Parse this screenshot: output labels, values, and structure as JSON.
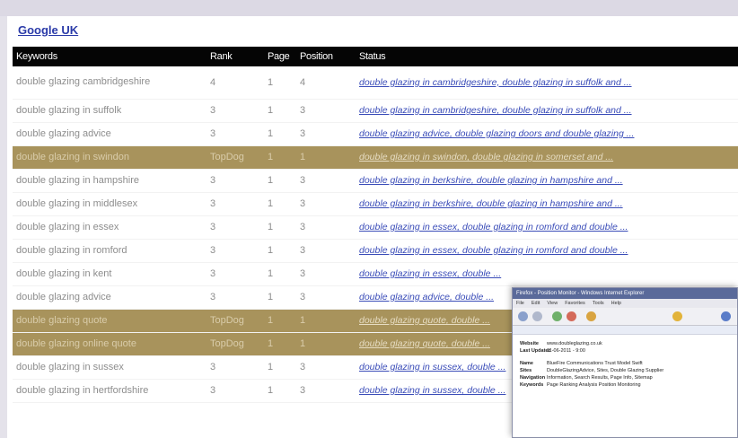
{
  "region_link": "Google UK",
  "table": {
    "headers": [
      "Keywords",
      "Rank",
      "Page",
      "Position",
      "Status"
    ],
    "rows": [
      {
        "keyword": "double glazing cambridgeshire",
        "rank": "4",
        "page": "1",
        "position": "4",
        "status": "double glazing in cambridgeshire, double glazing in suffolk and ...",
        "highlight": false
      },
      {
        "keyword": "double glazing in suffolk",
        "rank": "3",
        "page": "1",
        "position": "3",
        "status": "double glazing in cambridgeshire, double glazing in suffolk and ...",
        "highlight": false
      },
      {
        "keyword": "double glazing advice",
        "rank": "3",
        "page": "1",
        "position": "3",
        "status": "double glazing advice, double glazing doors and double glazing ...",
        "highlight": false
      },
      {
        "keyword": "double glazing in swindon",
        "rank": "TopDog",
        "page": "1",
        "position": "1",
        "status": "double glazing in swindon, double glazing in somerset and ...",
        "highlight": true
      },
      {
        "keyword": "double glazing in hampshire",
        "rank": "3",
        "page": "1",
        "position": "3",
        "status": "double glazing in berkshire, double glazing in hampshire and ...",
        "highlight": false
      },
      {
        "keyword": "double glazing in middlesex",
        "rank": "3",
        "page": "1",
        "position": "3",
        "status": "double glazing in berkshire, double glazing in hampshire and ...",
        "highlight": false
      },
      {
        "keyword": "double glazing in essex",
        "rank": "3",
        "page": "1",
        "position": "3",
        "status": "double glazing in essex, double glazing in romford and double ...",
        "highlight": false
      },
      {
        "keyword": "double glazing in romford",
        "rank": "3",
        "page": "1",
        "position": "3",
        "status": "double glazing in essex, double glazing in romford and double ...",
        "highlight": false
      },
      {
        "keyword": "double glazing in kent",
        "rank": "3",
        "page": "1",
        "position": "3",
        "status": "double glazing in essex, double ...",
        "highlight": false
      },
      {
        "keyword": "double glazing advice",
        "rank": "3",
        "page": "1",
        "position": "3",
        "status": "double glazing advice, double ...",
        "highlight": false
      },
      {
        "keyword": "double glazing quote",
        "rank": "TopDog",
        "page": "1",
        "position": "1",
        "status": "double glazing quote, double ...",
        "highlight": true
      },
      {
        "keyword": "double glazing online quote",
        "rank": "TopDog",
        "page": "1",
        "position": "1",
        "status": "double glazing quote, double ...",
        "highlight": true
      },
      {
        "keyword": "double glazing in sussex",
        "rank": "3",
        "page": "1",
        "position": "3",
        "status": "double glazing in sussex, double ...",
        "highlight": false
      },
      {
        "keyword": "double glazing in hertfordshire",
        "rank": "3",
        "page": "1",
        "position": "3",
        "status": "double glazing in sussex, double ...",
        "highlight": false
      }
    ]
  },
  "thumbnail": {
    "title": "Firefox - Position Monitor - Windows Internet Explorer",
    "menu": [
      "File",
      "Edit",
      "View",
      "Favorites",
      "Tools",
      "Help"
    ],
    "fields": [
      {
        "label": "Website",
        "value": "www.doubleglazing.co.uk"
      },
      {
        "label": "Last Updated",
        "value": "11-06-2011 - 9:00"
      },
      {
        "label": "Name",
        "value": "BlueFire Communications Trust Model Swift"
      },
      {
        "label": "Sites",
        "value": "DoubleGlazingAdvice, Sites, Double Glazing Supplier"
      },
      {
        "label": "Navigation",
        "value": "Information, Search Results, Page Info, Sitemap"
      },
      {
        "label": "Keywords",
        "value": "Page Ranking Analysis Position Monitoring"
      }
    ]
  },
  "colors": {
    "header_bg": "#050505",
    "highlight_row": "#a8935c",
    "link": "#3a4cb8"
  }
}
